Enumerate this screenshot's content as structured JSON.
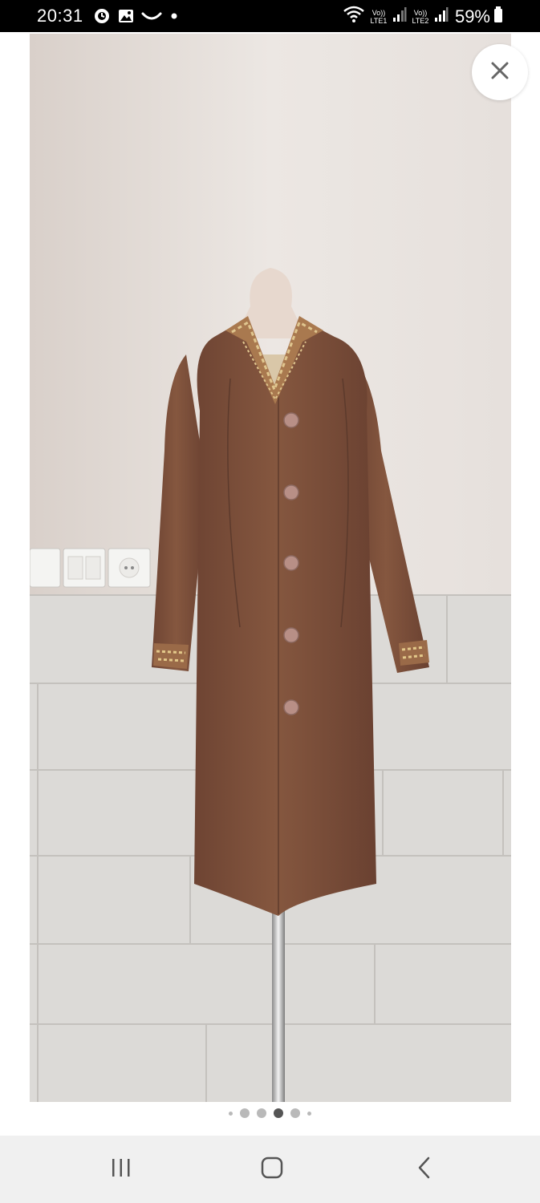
{
  "status_bar": {
    "time": "20:31",
    "left_icons": [
      "alarm-icon",
      "gallery-icon",
      "messaging-icon",
      "notification-dot-icon"
    ],
    "sim1_label_top": "Vo))",
    "sim1_label_bottom": "LTE1",
    "sim2_label_top": "Vo))",
    "sim2_label_bottom": "LTE2",
    "battery": "59%"
  },
  "viewer": {
    "close_icon": "close-icon",
    "pager": {
      "count": 6,
      "active_index": 3
    }
  },
  "nav_bar": {
    "icons": [
      "recent-apps-icon",
      "home-icon",
      "back-icon"
    ]
  },
  "colors": {
    "status_bar_bg": "#000000",
    "nav_bar_bg": "#f0f0f0",
    "garment": "#7a4f3a",
    "embroidery": "#c9a667",
    "wall": "#e9e3de"
  }
}
